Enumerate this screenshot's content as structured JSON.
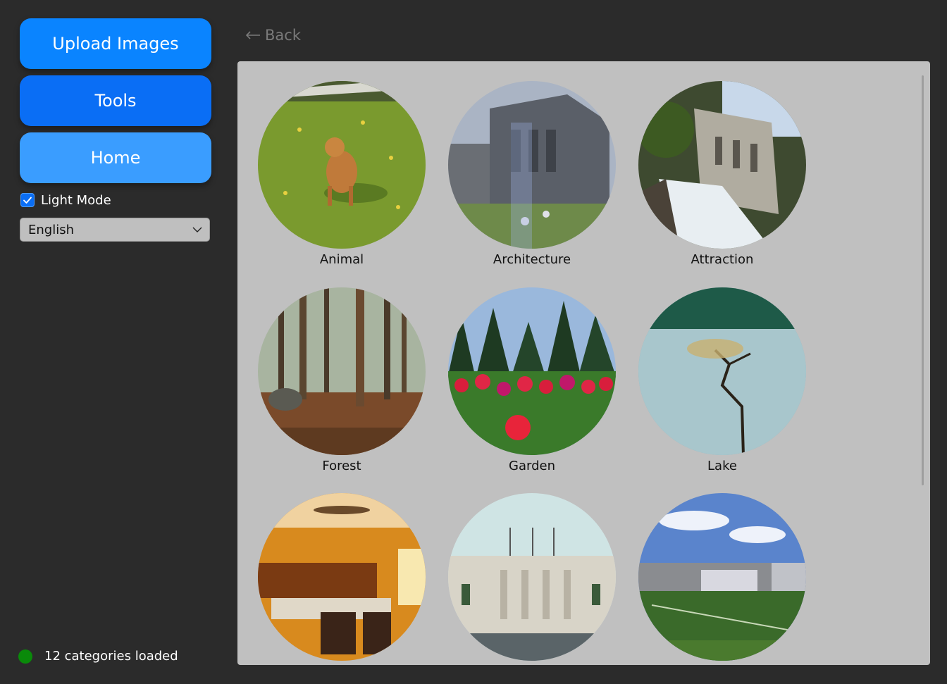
{
  "sidebar": {
    "upload_label": "Upload Images",
    "tools_label": "Tools",
    "home_label": "Home",
    "light_mode_label": "Light Mode",
    "light_mode_checked": true,
    "language_value": "English",
    "status_text": "12 categories loaded",
    "status_color": "#0a8a0a"
  },
  "main": {
    "back_label": "Back",
    "categories": [
      {
        "label": "Animal",
        "icon": "dog-on-grass"
      },
      {
        "label": "Architecture",
        "icon": "stone-building"
      },
      {
        "label": "Attraction",
        "icon": "waterfall-ruins"
      },
      {
        "label": "Forest",
        "icon": "forest-trees"
      },
      {
        "label": "Garden",
        "icon": "tulip-garden"
      },
      {
        "label": "Lake",
        "icon": "lake-tree"
      },
      {
        "label": "",
        "icon": "library-room"
      },
      {
        "label": "",
        "icon": "museum-facade"
      },
      {
        "label": "",
        "icon": "sports-field"
      }
    ]
  },
  "colors": {
    "accent": "#0a84ff",
    "background": "#2b2b2b",
    "panel": "#c0c0c0"
  }
}
